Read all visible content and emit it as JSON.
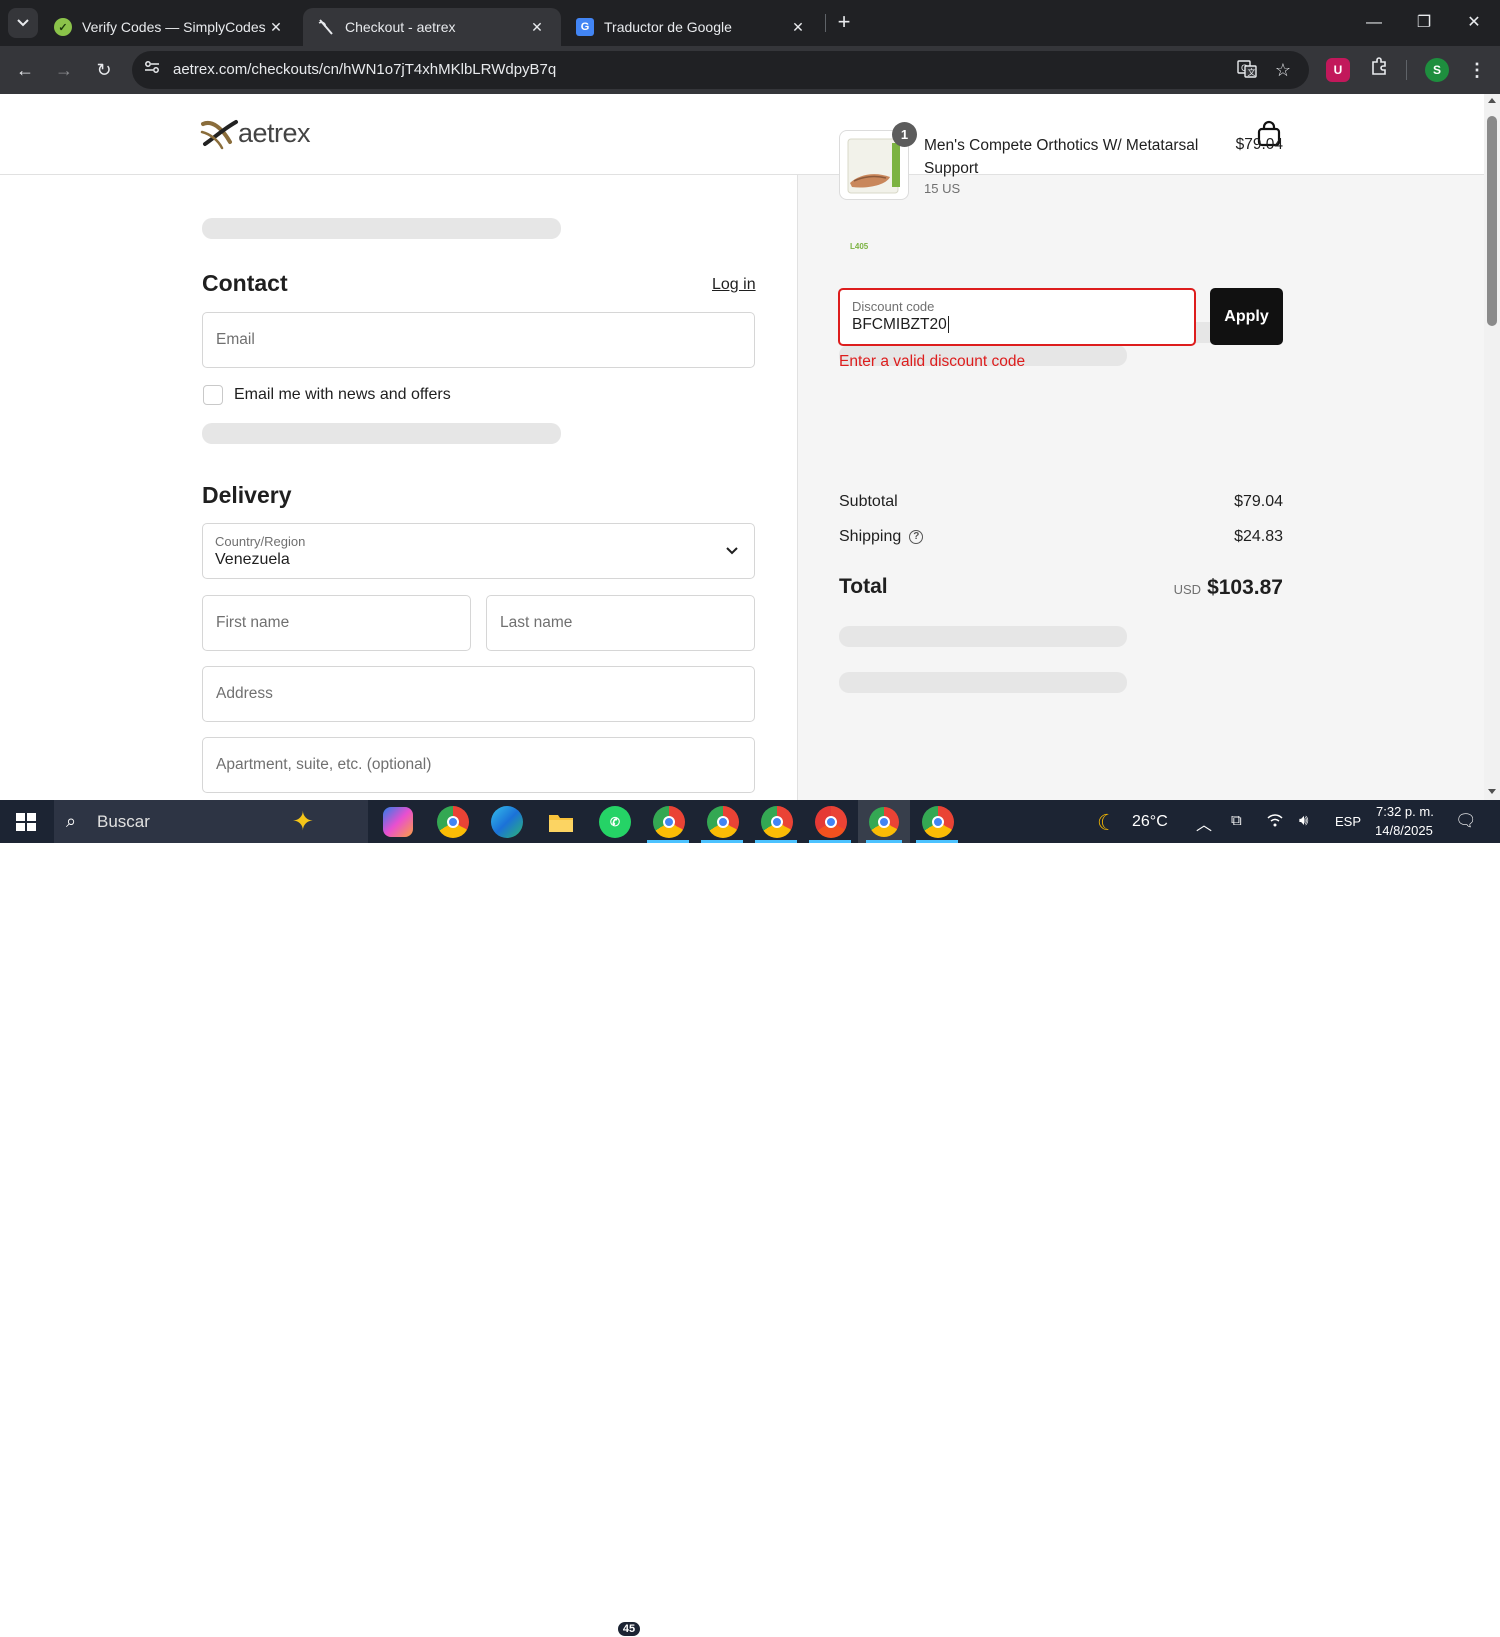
{
  "browser": {
    "tabs": [
      {
        "title": "Verify Codes — SimplyCodes",
        "active": false
      },
      {
        "title": "Checkout - aetrex",
        "active": true
      },
      {
        "title": "Traductor de Google",
        "active": false
      }
    ],
    "url": "aetrex.com/checkouts/cn/hWN1o7jT4xhMKlbLRWdpyB7q",
    "profile_initial": "S",
    "extension_initial": "U",
    "colors": {
      "accent": "#35363a",
      "frame": "#202124"
    }
  },
  "site": {
    "logo_text": "aetrex"
  },
  "contact": {
    "title": "Contact",
    "login_label": "Log in",
    "email_placeholder": "Email",
    "newsletter_label": "Email me with news and offers"
  },
  "delivery": {
    "title": "Delivery",
    "country_label": "Country/Region",
    "country_value": "Venezuela",
    "first_name_placeholder": "First name",
    "last_name_placeholder": "Last name",
    "address_placeholder": "Address",
    "apartment_placeholder": "Apartment, suite, etc. (optional)"
  },
  "order": {
    "product": {
      "name": "Men's Compete Orthotics W/ Metatarsal Support",
      "variant": "15 US",
      "price": "$79.04",
      "quantity": "1",
      "thumb_label": "L405"
    },
    "discount": {
      "label": "Discount code",
      "value": "BFCMIBZT20",
      "apply_label": "Apply",
      "error": "Enter a valid discount code",
      "error_color": "#dd1d1d"
    },
    "subtotal_label": "Subtotal",
    "subtotal_value": "$79.04",
    "shipping_label": "Shipping",
    "shipping_value": "$24.83",
    "total_label": "Total",
    "total_currency": "USD",
    "total_value": "$103.87"
  },
  "taskbar": {
    "search_label": "Buscar",
    "whatsapp_badge": "45",
    "weather": "26°C",
    "language": "ESP",
    "time": "7:32 p. m.",
    "date": "14/8/2025"
  }
}
